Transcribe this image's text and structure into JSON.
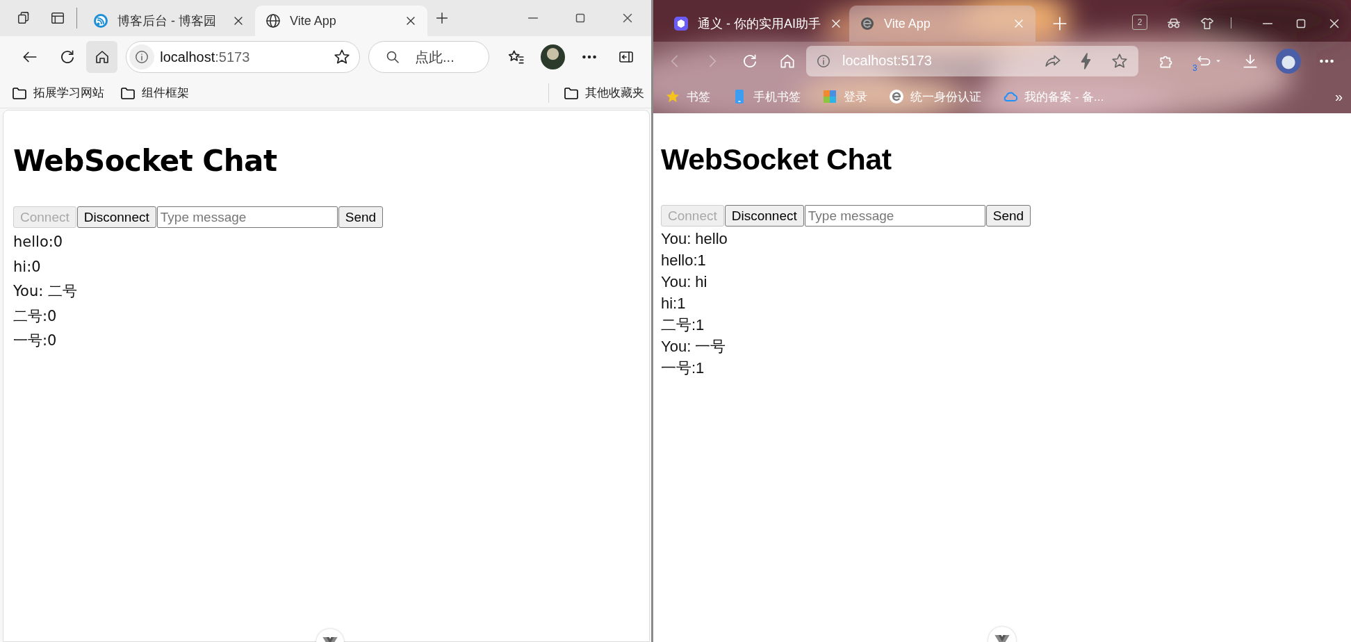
{
  "windows": [
    {
      "kind": "light",
      "tabs": [
        {
          "title": "博客后台 - 博客园",
          "selected": false
        },
        {
          "title": "Vite App",
          "selected": true
        }
      ],
      "back": {
        "disabled": false
      },
      "address": {
        "host": "localhost",
        "port": ":5173"
      },
      "search": {
        "placeholder": "点此..."
      },
      "bookmarks": [
        {
          "label": "拓展学习网站"
        },
        {
          "label": "组件框架"
        }
      ],
      "other_bookmarks": "其他收藏夹",
      "page": {
        "heading": "WebSocket Chat",
        "connect": {
          "label": "Connect",
          "disabled": true
        },
        "disconnect": {
          "label": "Disconnect",
          "disabled": false
        },
        "message_field": {
          "placeholder": "Type message"
        },
        "send": {
          "label": "Send"
        },
        "messages": [
          "hello:0",
          "hi:0",
          "You: 二号",
          "二号:0",
          "一号:0"
        ]
      }
    },
    {
      "kind": "themed",
      "tabs": [
        {
          "title": "通义 - 你的实用AI助手",
          "selected": false
        },
        {
          "title": "Vite App",
          "selected": true
        }
      ],
      "tab_count": "2",
      "back": {
        "disabled": true
      },
      "forward": {
        "disabled": true
      },
      "address": {
        "host": "localhost",
        "port": ":5173"
      },
      "sync_count": "3",
      "bookmarks": [
        {
          "label": "书签"
        },
        {
          "label": "手机书签"
        },
        {
          "label": "登录"
        },
        {
          "label": "统一身份认证"
        },
        {
          "label": "我的备案 - 备..."
        }
      ],
      "more_bookmarks": "»",
      "page": {
        "heading": "WebSocket Chat",
        "connect": {
          "label": "Connect",
          "disabled": true
        },
        "disconnect": {
          "label": "Disconnect",
          "disabled": false
        },
        "message_field": {
          "placeholder": "Type message"
        },
        "send": {
          "label": "Send"
        },
        "messages": [
          "You: hello",
          "hello:1",
          "You: hi",
          "hi:1",
          "二号:1",
          "You: 一号",
          "一号:1"
        ]
      }
    }
  ]
}
